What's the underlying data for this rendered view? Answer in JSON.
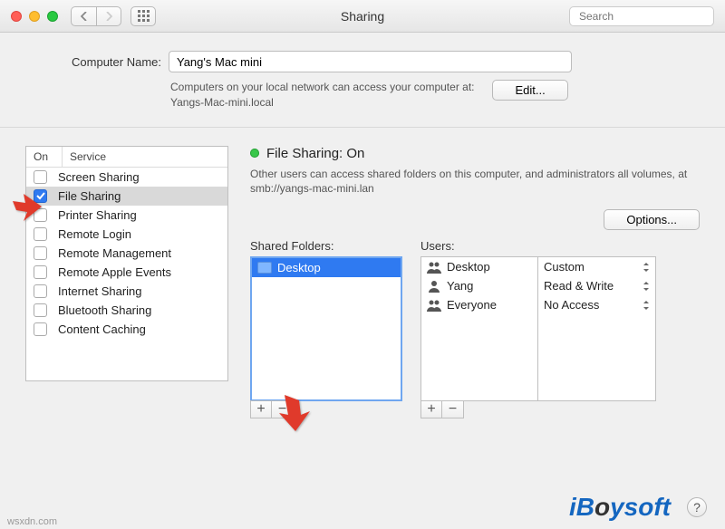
{
  "window": {
    "title": "Sharing",
    "search_placeholder": "Search"
  },
  "top": {
    "label": "Computer Name:",
    "value": "Yang's Mac mini",
    "info_line1": "Computers on your local network can access your computer at:",
    "info_line2": "Yangs-Mac-mini.local",
    "edit_btn": "Edit..."
  },
  "services": {
    "header_on": "On",
    "header_service": "Service",
    "items": [
      {
        "label": "Screen Sharing",
        "on": false
      },
      {
        "label": "File Sharing",
        "on": true,
        "selected": true
      },
      {
        "label": "Printer Sharing",
        "on": false
      },
      {
        "label": "Remote Login",
        "on": false
      },
      {
        "label": "Remote Management",
        "on": false
      },
      {
        "label": "Remote Apple Events",
        "on": false
      },
      {
        "label": "Internet Sharing",
        "on": false
      },
      {
        "label": "Bluetooth Sharing",
        "on": false
      },
      {
        "label": "Content Caching",
        "on": false
      }
    ]
  },
  "detail": {
    "status_title": "File Sharing: On",
    "status_desc": "Other users can access shared folders on this computer, and administrators all volumes, at smb://yangs-mac-mini.lan",
    "options_btn": "Options...",
    "shared_folders_label": "Shared Folders:",
    "users_label": "Users:",
    "folders": [
      {
        "name": "Desktop"
      }
    ],
    "users": [
      {
        "name": "Desktop",
        "icon": "group"
      },
      {
        "name": "Yang",
        "icon": "person"
      },
      {
        "name": "Everyone",
        "icon": "group"
      }
    ],
    "perms": [
      {
        "label": "Custom"
      },
      {
        "label": "Read & Write"
      },
      {
        "label": "No Access"
      }
    ],
    "plus": "+",
    "minus": "−"
  },
  "footer": {
    "brand": "iBoysoft",
    "help": "?",
    "watermark": "wsxdn.com"
  }
}
